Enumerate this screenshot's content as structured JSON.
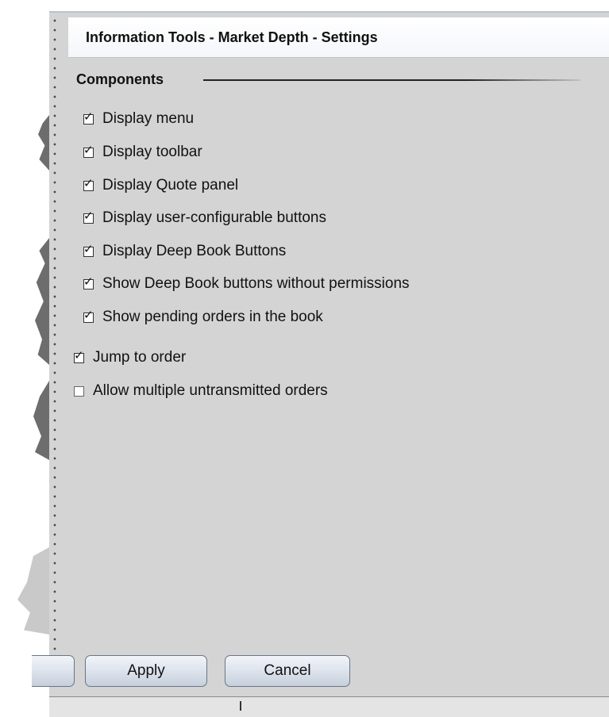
{
  "window": {
    "title": "Information Tools - Market Depth - Settings"
  },
  "section": {
    "label": "Components"
  },
  "options": [
    {
      "label": "Display menu",
      "checked": true
    },
    {
      "label": "Display toolbar",
      "checked": true
    },
    {
      "label": "Display Quote panel",
      "checked": true
    },
    {
      "label": "Display user-configurable buttons",
      "checked": true
    },
    {
      "label": "Display Deep Book Buttons",
      "checked": true
    },
    {
      "label": "Show Deep Book buttons without permissions",
      "checked": true
    },
    {
      "label": "Show pending orders in the book",
      "checked": true
    },
    {
      "label": "Jump to order",
      "checked": true
    },
    {
      "label": "Allow multiple untransmitted orders",
      "checked": false
    }
  ],
  "buttons": {
    "apply": "Apply",
    "cancel": "Cancel"
  },
  "icons": {
    "checked": "checkbox-checked-icon",
    "unchecked": "checkbox-unchecked-icon"
  }
}
